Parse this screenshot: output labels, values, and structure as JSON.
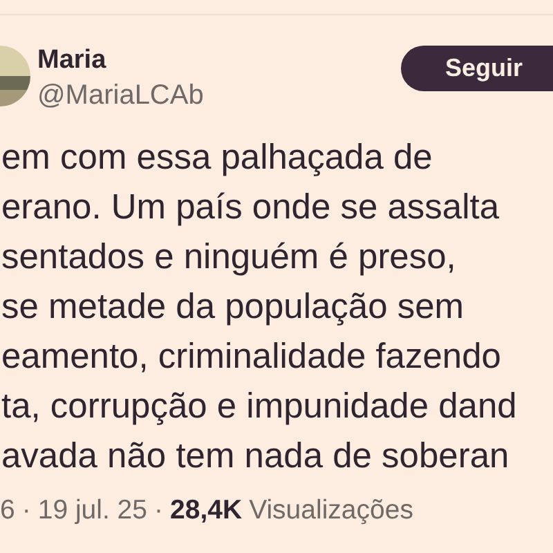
{
  "author": {
    "name": "Maria",
    "handle": "@MariaLCAb"
  },
  "follow_button": "Seguir",
  "body_lines": [
    "em com essa palhaçada de",
    "erano. Um país onde se assalta",
    "sentados e ninguém é preso,",
    "se metade da população sem",
    "eamento, criminalidade fazendo",
    "ta, corrupção e impunidade dand",
    "avada não tem nada de soberan"
  ],
  "meta": {
    "separator": "·",
    "time": "6",
    "date": "19 jul. 25",
    "views_count": "28,4K",
    "views_label": "Visualizações"
  }
}
